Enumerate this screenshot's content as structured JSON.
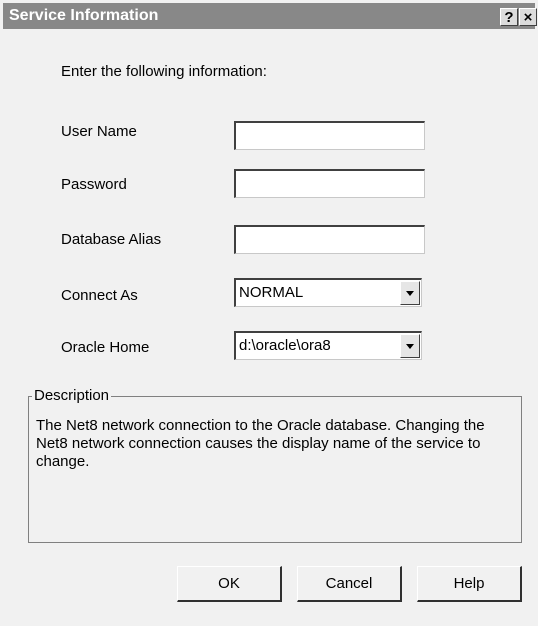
{
  "window": {
    "title": "Service Information",
    "help_label": "?",
    "close_label": "×"
  },
  "intro": "Enter the following information:",
  "form": {
    "user_name": {
      "label": "User Name",
      "value": ""
    },
    "password": {
      "label": "Password",
      "value": ""
    },
    "database_alias": {
      "label": "Database Alias",
      "value": ""
    },
    "connect_as": {
      "label": "Connect As",
      "value": "NORMAL"
    },
    "oracle_home": {
      "label": "Oracle Home",
      "value": "d:\\oracle\\ora8"
    }
  },
  "description": {
    "label": "Description",
    "text": "The Net8 network connection to the Oracle database. Changing the Net8 network connection causes the display name of the service to change."
  },
  "buttons": {
    "ok": "OK",
    "cancel": "Cancel",
    "help": "Help"
  },
  "colors": {
    "title_bar": "#888888",
    "dialog_bg": "#f1f1f1"
  }
}
